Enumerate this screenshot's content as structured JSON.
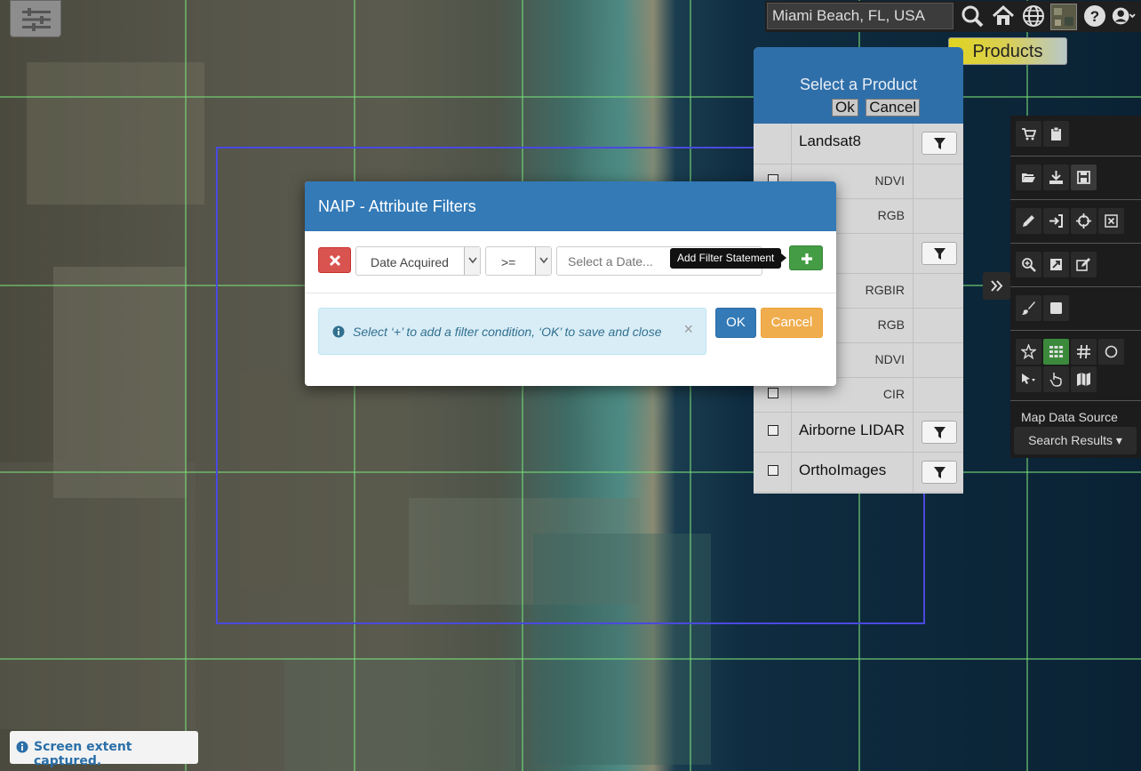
{
  "topbar": {
    "search_value": "Miami Beach, FL, USA"
  },
  "products_tab": {
    "label": "Products"
  },
  "product_panel": {
    "title": "Select a Product",
    "ok_label": "Ok",
    "cancel_label": "Cancel",
    "rows": [
      {
        "label": "Landsat8",
        "sub": "",
        "has_filter": true,
        "has_checkbox": false
      },
      {
        "label": "",
        "sub": "NDVI",
        "has_filter": false,
        "has_checkbox": true
      },
      {
        "label": "",
        "sub": "RGB",
        "has_filter": false,
        "has_checkbox": true
      },
      {
        "label": "",
        "sub": "",
        "has_filter": true,
        "has_checkbox": true
      },
      {
        "label": "",
        "sub": "RGBIR",
        "has_filter": false,
        "has_checkbox": true
      },
      {
        "label": "",
        "sub": "RGB",
        "has_filter": false,
        "has_checkbox": true
      },
      {
        "label": "",
        "sub": "NDVI",
        "has_filter": false,
        "has_checkbox": true
      },
      {
        "label": "",
        "sub": "CIR",
        "has_filter": false,
        "has_checkbox": true
      },
      {
        "label": "Airborne LIDAR",
        "sub": "",
        "has_filter": true,
        "has_checkbox": true
      },
      {
        "label": "OrthoImages",
        "sub": "",
        "has_filter": true,
        "has_checkbox": true
      }
    ]
  },
  "toolbar": {
    "map_data_label": "Map Data Source",
    "search_results_label": "Search Results ▾"
  },
  "modal": {
    "title": "NAIP - Attribute Filters",
    "attribute_value": "Date Acquired",
    "operator_value": ">=",
    "date_placeholder": "Select a Date...",
    "tooltip": "Add Filter Statement",
    "info_text": "Select ‘+’ to add a filter condition, ‘OK’ to save and close",
    "alert_close": "×",
    "ok_label": "OK",
    "cancel_label": "Cancel"
  },
  "toast": {
    "text": "Screen extent captured."
  },
  "colors": {
    "modal_header": "#337ab7",
    "danger": "#d9534f",
    "success": "#449d44",
    "warning": "#f0ad4e",
    "info_bg": "#d9edf7"
  }
}
